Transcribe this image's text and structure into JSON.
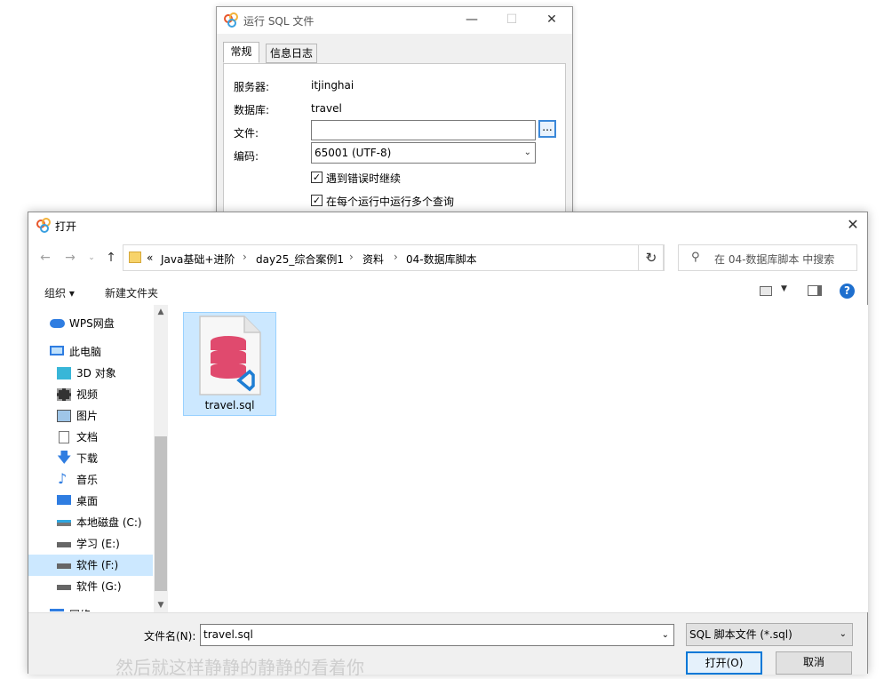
{
  "sql_dialog": {
    "title": "运行 SQL 文件",
    "tabs": [
      {
        "label": "常规"
      },
      {
        "label": "信息日志"
      }
    ],
    "server_label": "服务器:",
    "server_value": "itjinghai",
    "database_label": "数据库:",
    "database_value": "travel",
    "file_label": "文件:",
    "file_value": "",
    "browse_label": "...",
    "encoding_label": "编码:",
    "encoding_value": "65001 (UTF-8)",
    "continue_on_error_label": "遇到错误时继续",
    "continue_on_error_checked": true,
    "multi_query_label": "在每个运行中运行多个查询",
    "multi_query_checked": true
  },
  "open_dialog": {
    "title": "打开",
    "breadcrumb": {
      "overflow": "«",
      "items": [
        "Java基础+进阶",
        "day25_综合案例1",
        "资料",
        "04-数据库脚本"
      ]
    },
    "search_placeholder": "在 04-数据库脚本 中搜索",
    "toolbar": {
      "organize": "组织",
      "new_folder": "新建文件夹"
    },
    "nav": [
      {
        "label": "WPS网盘",
        "icon": "cloud-icon"
      },
      {
        "label": "此电脑",
        "icon": "computer-icon"
      },
      {
        "label": "3D 对象",
        "icon": "cube-icon"
      },
      {
        "label": "视频",
        "icon": "video-icon"
      },
      {
        "label": "图片",
        "icon": "picture-icon"
      },
      {
        "label": "文档",
        "icon": "document-icon"
      },
      {
        "label": "下载",
        "icon": "download-icon"
      },
      {
        "label": "音乐",
        "icon": "music-icon"
      },
      {
        "label": "桌面",
        "icon": "desktop-icon"
      },
      {
        "label": "本地磁盘 (C:)",
        "icon": "drive-c-icon"
      },
      {
        "label": "学习 (E:)",
        "icon": "drive-icon"
      },
      {
        "label": "软件 (F:)",
        "icon": "drive-icon",
        "selected": true
      },
      {
        "label": "软件 (G:)",
        "icon": "drive-icon"
      },
      {
        "label": "网络",
        "icon": "network-icon"
      }
    ],
    "files": [
      {
        "name": "travel.sql",
        "icon": "sql-file-icon"
      }
    ],
    "filename_label": "文件名(N):",
    "filename_value": "travel.sql",
    "filter_value": "SQL 脚本文件 (*.sql)",
    "open_button": "打开(O)",
    "cancel_button": "取消"
  },
  "watermark": "然后就这样静静的静静的看着你",
  "colors": {
    "accent": "#0078d7",
    "selection": "#cce8ff",
    "sql_db": "#e04a6e",
    "vscode": "#1e7ed4"
  }
}
